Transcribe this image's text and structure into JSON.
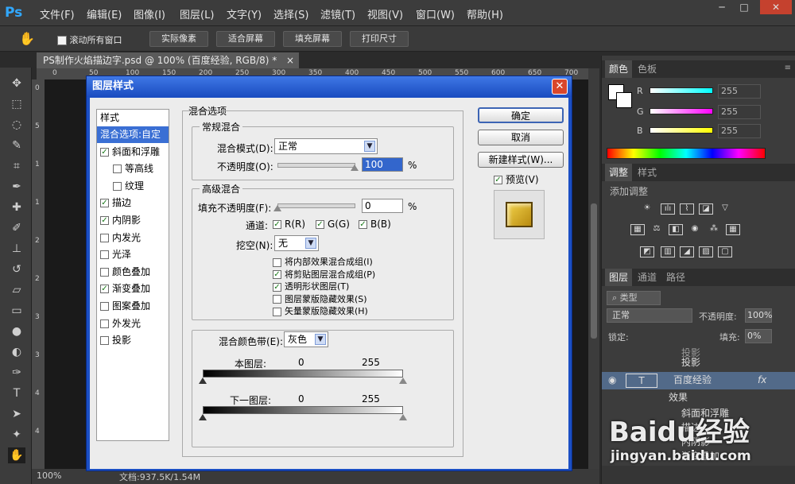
{
  "app": {
    "logo": "Ps"
  },
  "menu": [
    "文件(F)",
    "编辑(E)",
    "图像(I)",
    "图层(L)",
    "文字(Y)",
    "选择(S)",
    "滤镜(T)",
    "视图(V)",
    "窗口(W)",
    "帮助(H)"
  ],
  "window_controls": [
    "─",
    "□",
    "✕"
  ],
  "options": {
    "scroll_all_label": "滚动所有窗口",
    "buttons": [
      "实际像素",
      "适合屏幕",
      "填充屏幕",
      "打印尺寸"
    ]
  },
  "document": {
    "tab_title": "PS制作火焰描边字.psd @ 100% (百度经验, RGB/8) *",
    "tab_close": "×",
    "ruler_h": [
      "0",
      "50",
      "100",
      "150",
      "200",
      "250",
      "300",
      "350",
      "400",
      "450",
      "500",
      "550",
      "600",
      "650",
      "700"
    ],
    "ruler_v": [
      "0",
      "5",
      "1",
      "1",
      "2",
      "2",
      "3",
      "3",
      "4",
      "4"
    ]
  },
  "status": {
    "zoom": "100%",
    "doc": "文档:937.5K/1.54M"
  },
  "color_panel": {
    "tabs": [
      "颜色",
      "色板"
    ],
    "channels": [
      {
        "label": "R",
        "value": "255",
        "color": "#00ffff"
      },
      {
        "label": "G",
        "value": "255",
        "color": "#ff00ff"
      },
      {
        "label": "B",
        "value": "255",
        "color": "#ffff00"
      }
    ]
  },
  "adjust_panel": {
    "tabs": [
      "调整",
      "样式"
    ],
    "add_label": "添加调整"
  },
  "layers_panel": {
    "tabs": [
      "图层",
      "通道",
      "路径"
    ],
    "kind_label": "类型",
    "blend_mode": "正常",
    "opacity_label": "不透明度:",
    "opacity_value": "100%",
    "lock_label": "锁定:",
    "fill_label": "填充:",
    "fill_value": "0%",
    "rows": {
      "top_partial": "投影",
      "top_effect": "投影",
      "layer_name": "百度经验",
      "fx": "fx",
      "effects": "效果",
      "effect_items": [
        "斜面和浮雕",
        "描边",
        "内阴影",
        "渐变叠加"
      ]
    }
  },
  "watermark": {
    "brand": "Baidu经验",
    "url": "jingyan.baidu.com"
  },
  "dialog": {
    "title": "图层样式",
    "close": "✕",
    "styles_header": "样式",
    "styles": [
      {
        "label": "混合选项:自定",
        "checked": null,
        "selected": true
      },
      {
        "label": "斜面和浮雕",
        "checked": true
      },
      {
        "label": "等高线",
        "checked": false,
        "indent": true
      },
      {
        "label": "纹理",
        "checked": false,
        "indent": true
      },
      {
        "label": "描边",
        "checked": true
      },
      {
        "label": "内阴影",
        "checked": true
      },
      {
        "label": "内发光",
        "checked": false
      },
      {
        "label": "光泽",
        "checked": false
      },
      {
        "label": "颜色叠加",
        "checked": false
      },
      {
        "label": "渐变叠加",
        "checked": true
      },
      {
        "label": "图案叠加",
        "checked": false
      },
      {
        "label": "外发光",
        "checked": false
      },
      {
        "label": "投影",
        "checked": false
      }
    ],
    "blend_options_title": "混合选项",
    "general": {
      "title": "常规混合",
      "blend_mode_label": "混合模式(D):",
      "blend_mode_value": "正常",
      "opacity_label": "不透明度(O):",
      "opacity_value": "100",
      "opacity_unit": "%"
    },
    "advanced": {
      "title": "高级混合",
      "fill_label": "填充不透明度(F):",
      "fill_value": "0",
      "fill_unit": "%",
      "channels_label": "通道:",
      "channels": [
        "R(R)",
        "G(G)",
        "B(B)"
      ],
      "knockout_label": "挖空(N):",
      "knockout_value": "无",
      "options": [
        {
          "label": "将内部效果混合成组(I)",
          "checked": false
        },
        {
          "label": "将剪贴图层混合成组(P)",
          "checked": true
        },
        {
          "label": "透明形状图层(T)",
          "checked": true
        },
        {
          "label": "图层蒙版隐藏效果(S)",
          "checked": false
        },
        {
          "label": "矢量蒙版隐藏效果(H)",
          "checked": false
        }
      ]
    },
    "blend_if": {
      "label": "混合颜色带(E):",
      "value": "灰色",
      "this_layer": "本图层:",
      "underlying": "下一图层:",
      "min": "0",
      "max": "255"
    },
    "buttons": {
      "ok": "确定",
      "cancel": "取消",
      "new_style": "新建样式(W)...",
      "preview": "预览(V)"
    }
  }
}
